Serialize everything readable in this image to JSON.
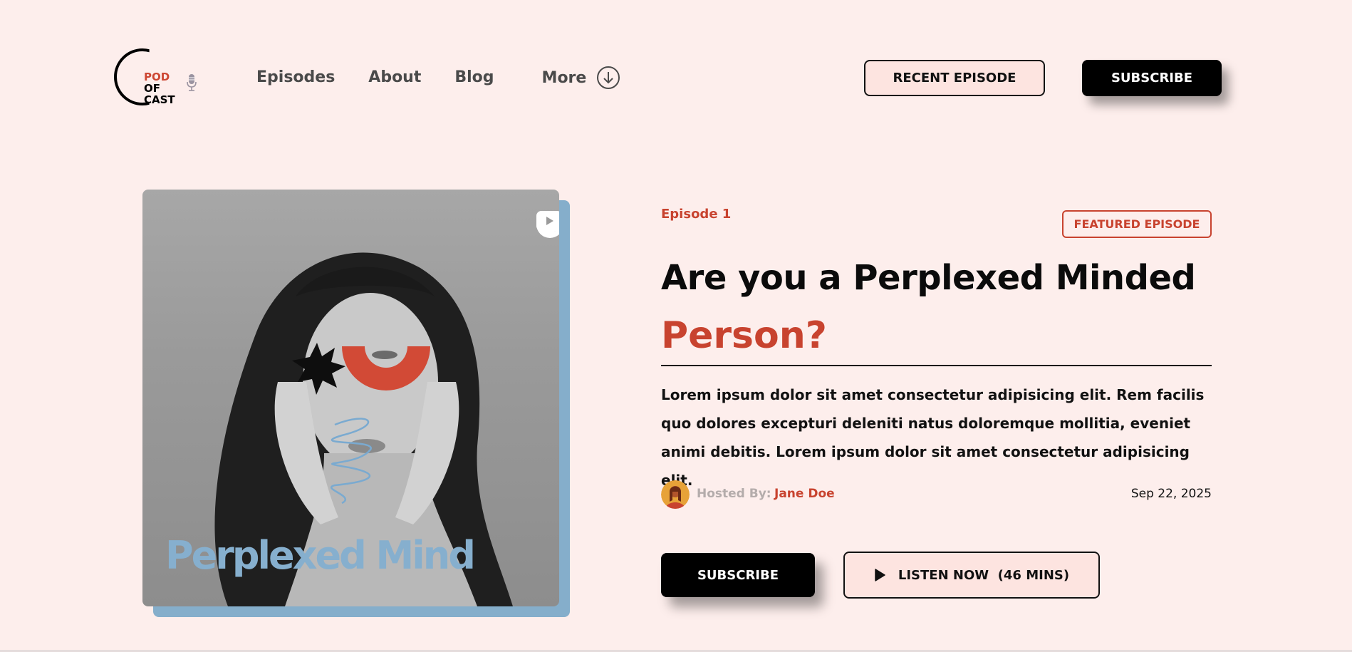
{
  "brand": {
    "logo_line1": "POD",
    "logo_line2": "OF",
    "logo_line3": "CAST",
    "accent_color": "#c8432f",
    "background_color": "#fdeeec"
  },
  "nav": {
    "items": [
      {
        "label": "Episodes"
      },
      {
        "label": "About"
      },
      {
        "label": "Blog"
      }
    ],
    "more_label": "More",
    "more_icon": "arrow-down-circle-icon"
  },
  "header_actions": {
    "recent_label": "RECENT EPISODE",
    "subscribe_label": "SUBSCRIBE"
  },
  "cover": {
    "title": "Perplexed Mind",
    "platform_icons": [
      "podcasts-icon",
      "spotify-icon",
      "youtube-icon"
    ]
  },
  "episode": {
    "number_label": "Episode 1",
    "badge": "FEATURED EPISODE",
    "title_line1": "Are you a Perplexed Minded",
    "title_line2": "Person?",
    "description": "Lorem ipsum dolor sit amet consectetur adipisicing elit. Rem facilis quo dolores excepturi deleniti natus doloremque mollitia, eveniet animi debitis. Lorem ipsum dolor sit amet consectetur adipisicing elit.",
    "hosted_by_label": "Hosted By:",
    "host_name": "Jane Doe",
    "date": "Sep 22, 2025",
    "subscribe_label": "SUBSCRIBE",
    "listen_label": "LISTEN NOW  (46 MINS)"
  }
}
